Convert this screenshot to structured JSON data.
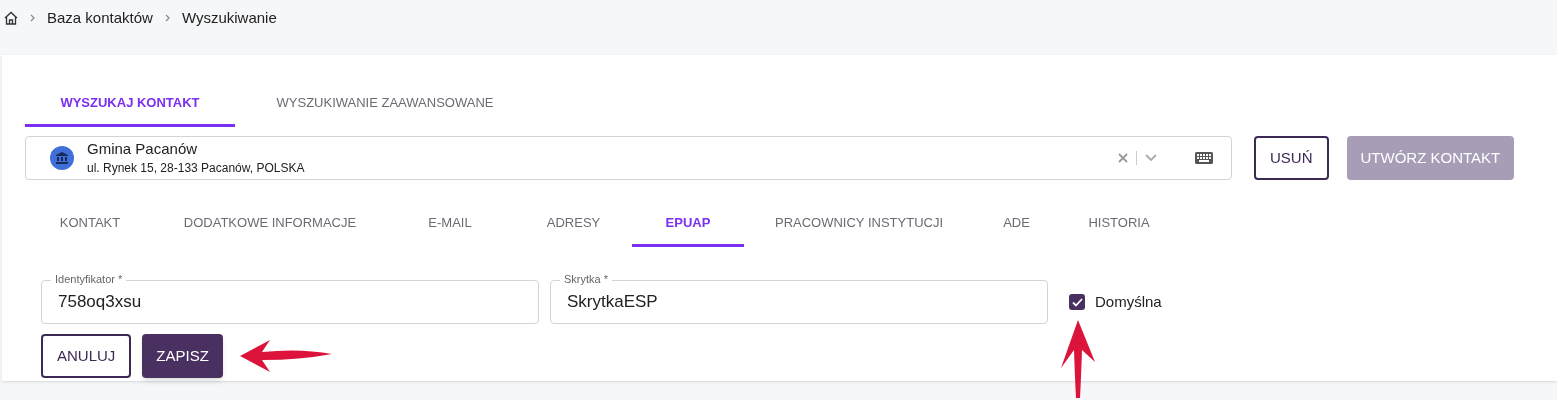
{
  "breadcrumb": [
    "Baza kontaktów",
    "Wyszukiwanie"
  ],
  "search_tabs": [
    {
      "label": "WYSZUKAJ KONTAKT",
      "selected": true
    },
    {
      "label": "WYSZUKIWANIE ZAAWANSOWANE",
      "selected": false
    }
  ],
  "contact_select": {
    "name": "Gmina Pacanów",
    "address": "ul. Rynek 15, 28-133 Pacanów, POLSKA"
  },
  "actions": [
    {
      "label": "USUŃ",
      "kind": "outline"
    },
    {
      "label": "UTWÓRZ KONTAKT",
      "kind": "filled",
      "disabled": true
    }
  ],
  "detail_tabs": [
    {
      "label": "KONTAKT",
      "selected": false
    },
    {
      "label": "DODATKOWE INFORMACJE",
      "selected": false
    },
    {
      "label": "E-MAIL",
      "selected": false
    },
    {
      "label": "ADRESY",
      "selected": false
    },
    {
      "label": "EPUAP",
      "selected": true
    },
    {
      "label": "PRACOWNICY INSTYTUCJI",
      "selected": false
    },
    {
      "label": "ADE",
      "selected": false
    },
    {
      "label": "HISTORIA",
      "selected": false
    }
  ],
  "fields": [
    {
      "label": "Identyfikator *",
      "value": "758oq3xsu"
    },
    {
      "label": "Skrytka *",
      "value": "SkrytkaESP"
    }
  ],
  "default_checkbox": {
    "label": "Domyślna",
    "checked": true
  },
  "form_buttons": [
    {
      "label": "ANULUJ",
      "kind": "outline"
    },
    {
      "label": "ZAPISZ",
      "kind": "filled"
    }
  ]
}
